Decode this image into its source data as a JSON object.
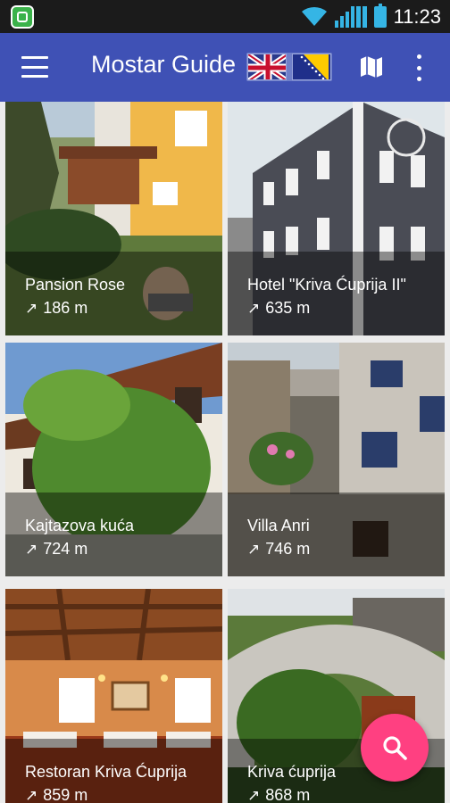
{
  "status_bar": {
    "time": "11:23"
  },
  "app_bar": {
    "title": "Mostar Guide"
  },
  "colors": {
    "primary": "#3f51b5",
    "accent": "#ff4081",
    "status_bar": "#1b1b1b"
  },
  "places": [
    {
      "name": "Pansion Rose",
      "distance": "186 m"
    },
    {
      "name": "Hotel \"Kriva Ćuprija II\"",
      "distance": "635 m"
    },
    {
      "name": "Kajtazova kuća",
      "distance": "724 m"
    },
    {
      "name": "Villa Anri",
      "distance": "746 m"
    },
    {
      "name": "Restoran Kriva Ćuprija",
      "distance": "859 m"
    },
    {
      "name": "Kriva ćuprija",
      "distance": "868 m"
    }
  ],
  "icons": {
    "menu": "menu-icon",
    "map": "map-icon",
    "more": "more-vert-icon",
    "search": "search-icon",
    "distance": "arrow-north-east-icon"
  }
}
